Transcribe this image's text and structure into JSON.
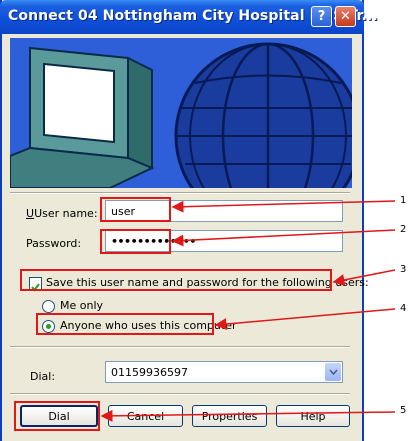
{
  "window": {
    "title": "Connect 04 Nottingham City Hospital NHS Tr...",
    "help_glyph": "?",
    "close_glyph": "✕"
  },
  "form": {
    "username_label": "User name:",
    "username_value": "user",
    "password_label": "Password:",
    "password_value": "•••••••••••••",
    "save_label": "Save this user name and password for the following users:",
    "me_only_label": "Me only",
    "anyone_label": "Anyone who uses this computer",
    "dial_label": "Dial:",
    "dial_value": "01159936597"
  },
  "buttons": {
    "dial": "Dial",
    "cancel": "Cancel",
    "properties": "Properties",
    "help": "Help"
  },
  "callouts": [
    "1",
    "2",
    "3",
    "4",
    "5"
  ],
  "colors": {
    "annotation": "#e01818",
    "titlebar": "#0f4fd8"
  }
}
